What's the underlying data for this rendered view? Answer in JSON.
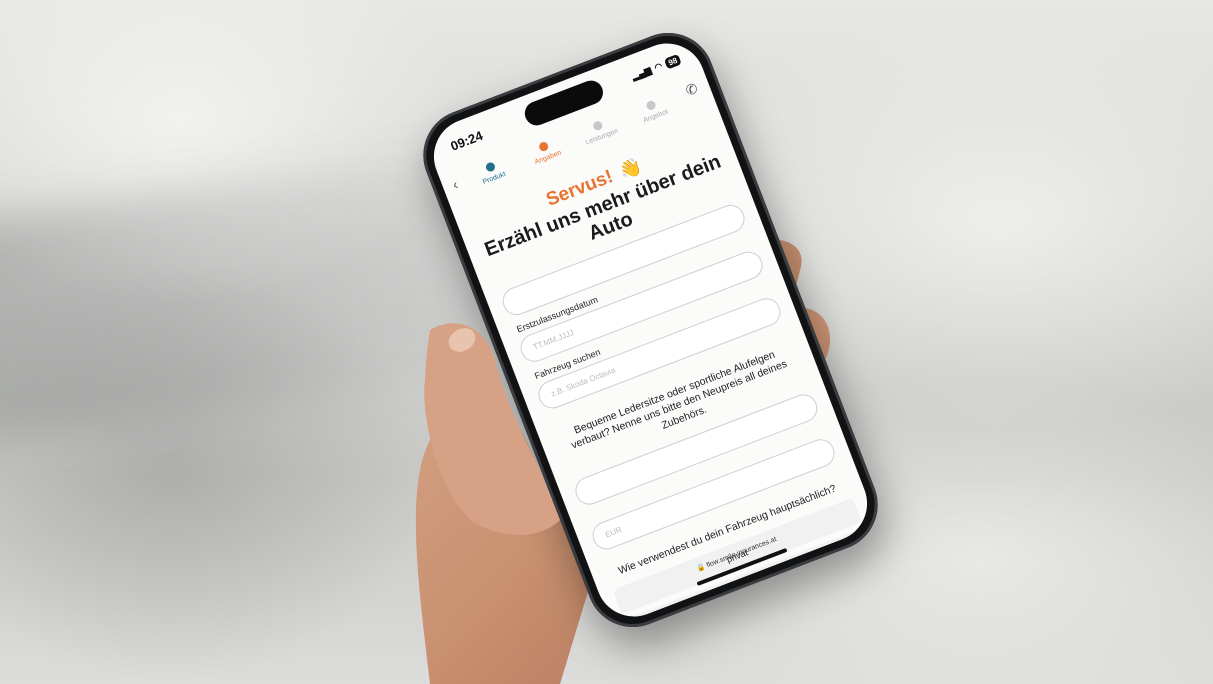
{
  "status_bar": {
    "time": "09:24",
    "battery": "98"
  },
  "progress": {
    "steps": [
      {
        "label": "Produkt",
        "state": "done"
      },
      {
        "label": "Angaben",
        "state": "active"
      },
      {
        "label": "Leistungen",
        "state": "pending"
      },
      {
        "label": "Angebot",
        "state": "pending"
      }
    ],
    "back_icon": "chevron-left-icon",
    "call_icon": "phone-icon"
  },
  "form": {
    "greeting": "Servus!",
    "greeting_icon": "waving-hand-icon",
    "headline": "Erzähl uns mehr über dein Auto",
    "registration_label": "Erstzulassungsdatum",
    "registration_placeholder": "TT.MM.JJJJ",
    "vehicle_label": "Fahrzeug suchen",
    "vehicle_placeholder": "z.B. Skoda Octavia",
    "accessories_text": "Bequeme Ledersitze oder sportliche Alufelgen verbaut? Nenne uns bitte den Neupreis all deines Zubehörs.",
    "accessories_placeholder": "EUR",
    "usage_question": "Wie verwendest du dein Fahrzeug hauptsächlich?",
    "usage_option_1": "privat"
  },
  "browser": {
    "url": "flow.smile-insurances.at",
    "lock_icon": "lock-icon"
  },
  "colors": {
    "accent": "#e8742f",
    "brand": "#1f6f88"
  }
}
